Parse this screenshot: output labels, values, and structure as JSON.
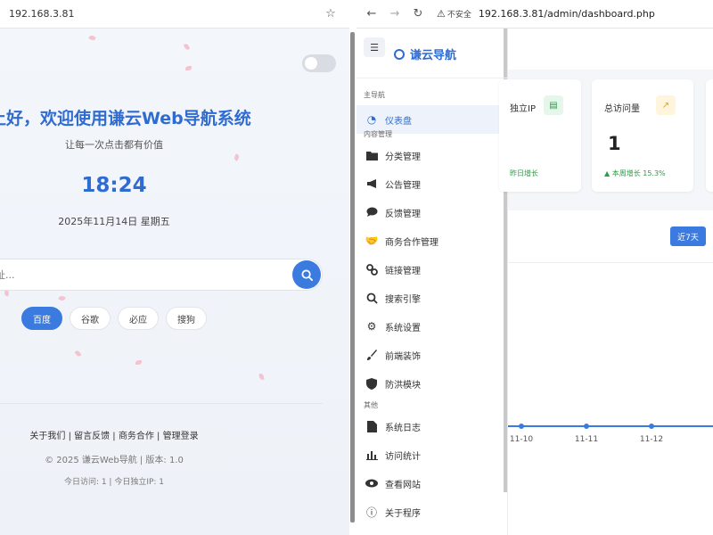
{
  "left_window": {
    "address": "192.168.3.81",
    "greeting": "上好，欢迎使用谦云Web导航系统",
    "slogan": "让每一次点击都有价值",
    "time": "18:24",
    "date": "2025年11月14日 星期五",
    "search_placeholder": "址...",
    "engines": [
      "百度",
      "谷歌",
      "必应",
      "搜狗"
    ],
    "footer_links": "关于我们 | 留言反馈 | 商务合作 | 管理登录",
    "copyright": "© 2025 谦云Web导航 | 版本: 1.0",
    "visit_stats": "今日访问: 1 | 今日独立IP: 1"
  },
  "right_window": {
    "not_secure": "不安全",
    "url": "192.168.3.81/admin/dashboard.php",
    "brand": "谦云导航",
    "sections": {
      "main": "主导航",
      "content": "内容管理",
      "other": "其他"
    },
    "dashboard": "仪表盘",
    "content_items": [
      "分类管理",
      "公告管理",
      "反馈管理",
      "商务合作管理",
      "链接管理",
      "搜索引擎",
      "系统设置",
      "前端装饰",
      "防洪模块"
    ],
    "other_items": [
      "系统日志",
      "访问统计",
      "查看网站",
      "关于程序"
    ],
    "cards": [
      {
        "title": "独立IP",
        "value": "",
        "trend": "昨日增长"
      },
      {
        "title": "总访问量",
        "value": "1",
        "trend": "本周增长 15.3%"
      }
    ],
    "range_button": "近7天"
  },
  "chart_data": {
    "type": "line",
    "x": [
      "11-10",
      "11-11",
      "11-12"
    ],
    "series": [
      {
        "values": [
          0,
          0,
          0
        ]
      }
    ],
    "color": "#3b7be0"
  },
  "colors": {
    "accent": "#2f6bd1",
    "button": "#3b7be0",
    "trend_green": "#2e9b46"
  }
}
